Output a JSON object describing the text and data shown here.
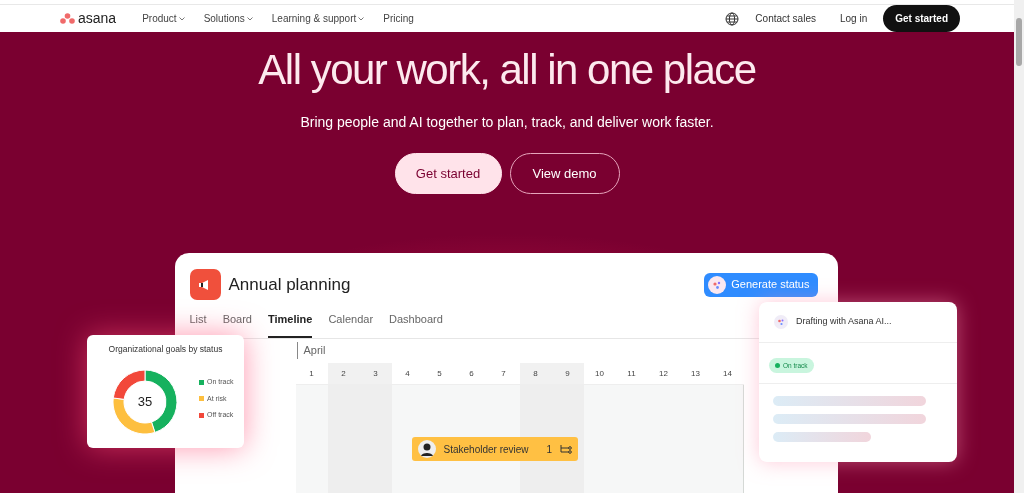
{
  "nav": {
    "logo": "asana",
    "links": [
      {
        "label": "Product",
        "dropdown": true
      },
      {
        "label": "Solutions",
        "dropdown": true
      },
      {
        "label": "Learning & support",
        "dropdown": true
      },
      {
        "label": "Pricing",
        "dropdown": false
      }
    ],
    "actions": [
      "Contact sales",
      "Log in"
    ],
    "cta": "Get started"
  },
  "hero": {
    "title": "All your work, all in one place",
    "subtitle": "Bring people and AI together to plan, track, and deliver work faster.",
    "buttons": [
      {
        "label": "Get started",
        "kind": "primary"
      },
      {
        "label": "View demo",
        "kind": "outline"
      }
    ]
  },
  "project": {
    "title": "Annual planning",
    "action": "Generate status",
    "tabs": [
      {
        "label": "List",
        "selected": false
      },
      {
        "label": "Board",
        "selected": false
      },
      {
        "label": "Timeline",
        "selected": true
      },
      {
        "label": "Calendar",
        "selected": false
      },
      {
        "label": "Dashboard",
        "selected": false
      }
    ],
    "month": "April",
    "days": [
      {
        "label": "1",
        "weekend": false,
        "today": false
      },
      {
        "label": "2",
        "weekend": true,
        "today": false
      },
      {
        "label": "3",
        "weekend": true,
        "today": false
      },
      {
        "label": "4",
        "weekend": false,
        "today": false
      },
      {
        "label": "5",
        "weekend": false,
        "today": false
      },
      {
        "label": "6",
        "weekend": false,
        "today": false
      },
      {
        "label": "7",
        "weekend": false,
        "today": false
      },
      {
        "label": "8",
        "weekend": true,
        "today": false
      },
      {
        "label": "9",
        "weekend": true,
        "today": false
      },
      {
        "label": "10",
        "weekend": false,
        "today": false
      },
      {
        "label": "11",
        "weekend": false,
        "today": false
      },
      {
        "label": "12",
        "weekend": false,
        "today": false
      },
      {
        "label": "13",
        "weekend": false,
        "today": false
      },
      {
        "label": "14",
        "weekend": false,
        "today": true
      }
    ],
    "task": {
      "label": "Stakeholder review",
      "count": "1"
    }
  },
  "goals_card": {
    "title": "Organizational goals by status",
    "total": "35",
    "legend": [
      {
        "label": "On track",
        "color": "#16b15e"
      },
      {
        "label": "At risk",
        "color": "#fdbf3f"
      },
      {
        "label": "Off track",
        "color": "#f2483a"
      }
    ]
  },
  "ai_card": {
    "title": "Drafting with Asana AI...",
    "status": "On track"
  }
}
